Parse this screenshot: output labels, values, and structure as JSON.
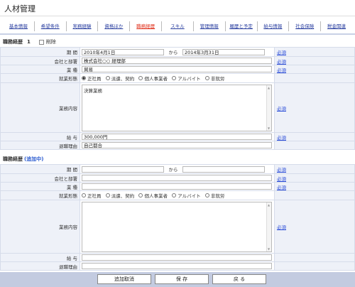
{
  "page": {
    "title": "人材管理"
  },
  "tabs": [
    {
      "label": "基本情報",
      "active": false
    },
    {
      "label": "希望条件",
      "active": false
    },
    {
      "label": "実務経験",
      "active": false
    },
    {
      "label": "資格ほか",
      "active": false
    },
    {
      "label": "職務経歴",
      "active": true
    },
    {
      "label": "スキル",
      "active": false
    },
    {
      "label": "管理情報",
      "active": false
    },
    {
      "label": "履歴と予定",
      "active": false
    },
    {
      "label": "給与情報",
      "active": false
    },
    {
      "label": "社会保険",
      "active": false
    },
    {
      "label": "税金関連",
      "active": false
    }
  ],
  "record1": {
    "heading": "職務経歴",
    "number": "1",
    "delete_label": "削除",
    "period_label": "期 間",
    "period_from": "2010年4月1日",
    "kara": "から",
    "period_to": "2014年3月31日",
    "company_label": "会社と部署",
    "company_value": "株式会社○○ 経理部",
    "industry_label": "業 種",
    "industry_value": "貿易",
    "employment_label": "就業形態",
    "employment_options": [
      "正社員",
      "派遣、契約",
      "個人事業者",
      "アルバイト",
      "非就労"
    ],
    "duties_label": "業務内容",
    "duties_value": "決算業務",
    "salary_label": "給 与",
    "salary_value": "300,000円",
    "reason_label": "退職理由",
    "reason_value": "自己都合",
    "required": "必須"
  },
  "record2": {
    "heading": "職務経歴",
    "adding": "(追加中)",
    "period_label": "期 間",
    "kara": "から",
    "company_label": "会社と部署",
    "industry_label": "業 種",
    "employment_label": "就業形態",
    "employment_options": [
      "正社員",
      "派遣、契約",
      "個人事業者",
      "アルバイト",
      "非就労"
    ],
    "duties_label": "業務内容",
    "salary_label": "給 与",
    "reason_label": "退職理由",
    "required": "必須"
  },
  "buttons": {
    "cancel_add": "追加取消",
    "save": "保 存",
    "back": "戻 る"
  }
}
